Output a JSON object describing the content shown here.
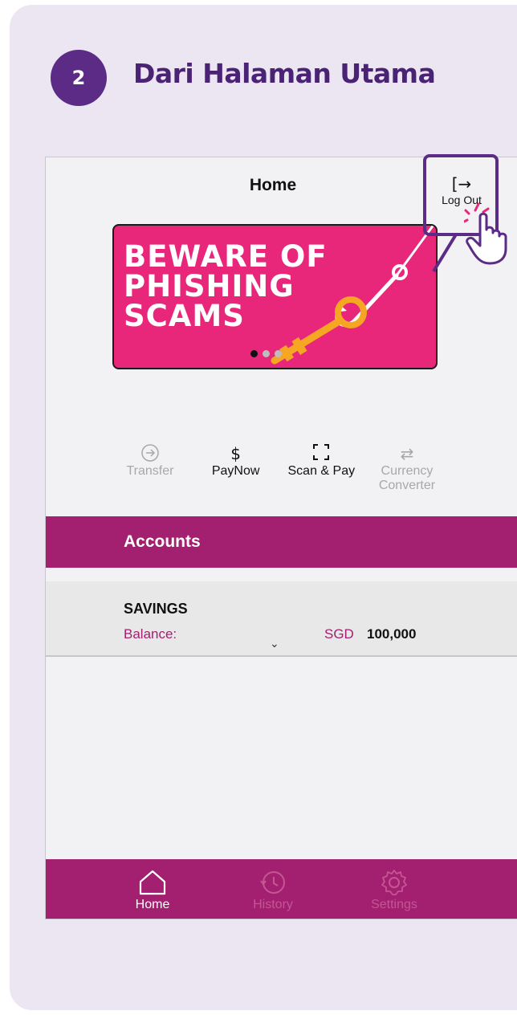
{
  "step": {
    "number": "2",
    "title": "Dari Halaman Utama"
  },
  "header": {
    "title": "Home",
    "logout_label": "Log Out",
    "logout_icon": "logout-icon"
  },
  "banner": {
    "lines": [
      "BEWARE OF",
      "PHISHING",
      "SCAMS"
    ],
    "slide_count": 3,
    "active_slide": 1
  },
  "quick_actions": [
    {
      "label": "Transfer",
      "icon": "transfer-icon",
      "enabled": false
    },
    {
      "label": "PayNow",
      "icon": "dollar-icon",
      "enabled": true
    },
    {
      "label": "Scan & Pay",
      "icon": "scan-icon",
      "enabled": true
    },
    {
      "label": "Currency Converter",
      "icon": "swap-icon",
      "enabled": false
    }
  ],
  "accounts": {
    "heading": "Accounts",
    "items": [
      {
        "name": "SAVINGS",
        "balance_label": "Balance:",
        "currency": "SGD",
        "amount": "100,000"
      }
    ]
  },
  "tabs": [
    {
      "label": "Home",
      "icon": "home-icon",
      "active": true
    },
    {
      "label": "History",
      "icon": "history-icon",
      "active": false
    },
    {
      "label": "Settings",
      "icon": "settings-icon",
      "active": false
    }
  ],
  "colors": {
    "background": "#ebe6f1",
    "brand_purple": "#5b2b86",
    "brand_magenta": "#a31f6f",
    "banner_pink": "#e8267a",
    "key_orange": "#f5a623"
  }
}
